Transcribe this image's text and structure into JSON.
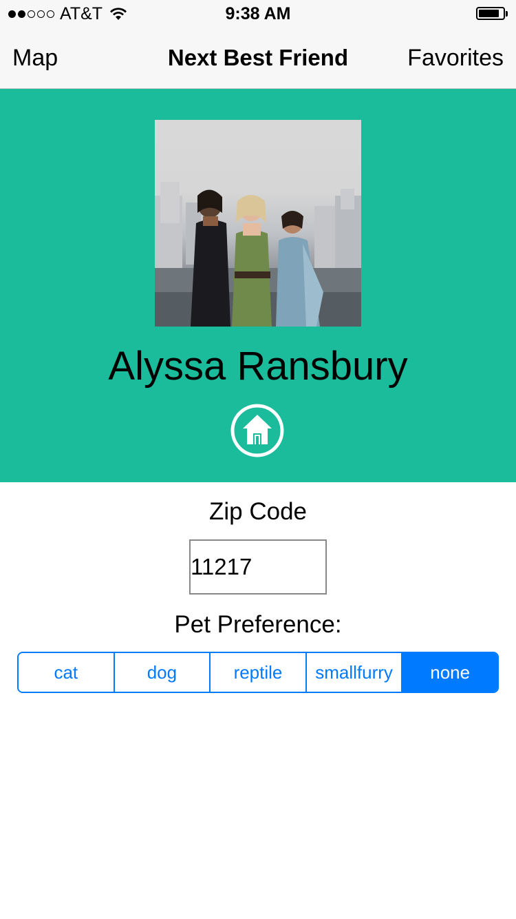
{
  "status_bar": {
    "carrier": "AT&T",
    "time": "9:38 AM",
    "signal_bars_filled": 2,
    "signal_bars_total": 5,
    "battery_level": 0.85,
    "icons": [
      "signal-dots-icon",
      "wifi-icon",
      "battery-icon"
    ]
  },
  "nav": {
    "left_label": "Map",
    "title": "Next Best Friend",
    "right_label": "Favorites"
  },
  "profile": {
    "name": "Alyssa Ransbury",
    "home_icon": "home-icon",
    "header_color": "#1abc9c"
  },
  "zip": {
    "label": "Zip Code",
    "value": "11217"
  },
  "pet_preference": {
    "label": "Pet Preference:",
    "options": [
      "cat",
      "dog",
      "reptile",
      "smallfurry",
      "none"
    ],
    "selected": "none",
    "accent_color": "#007aff"
  }
}
